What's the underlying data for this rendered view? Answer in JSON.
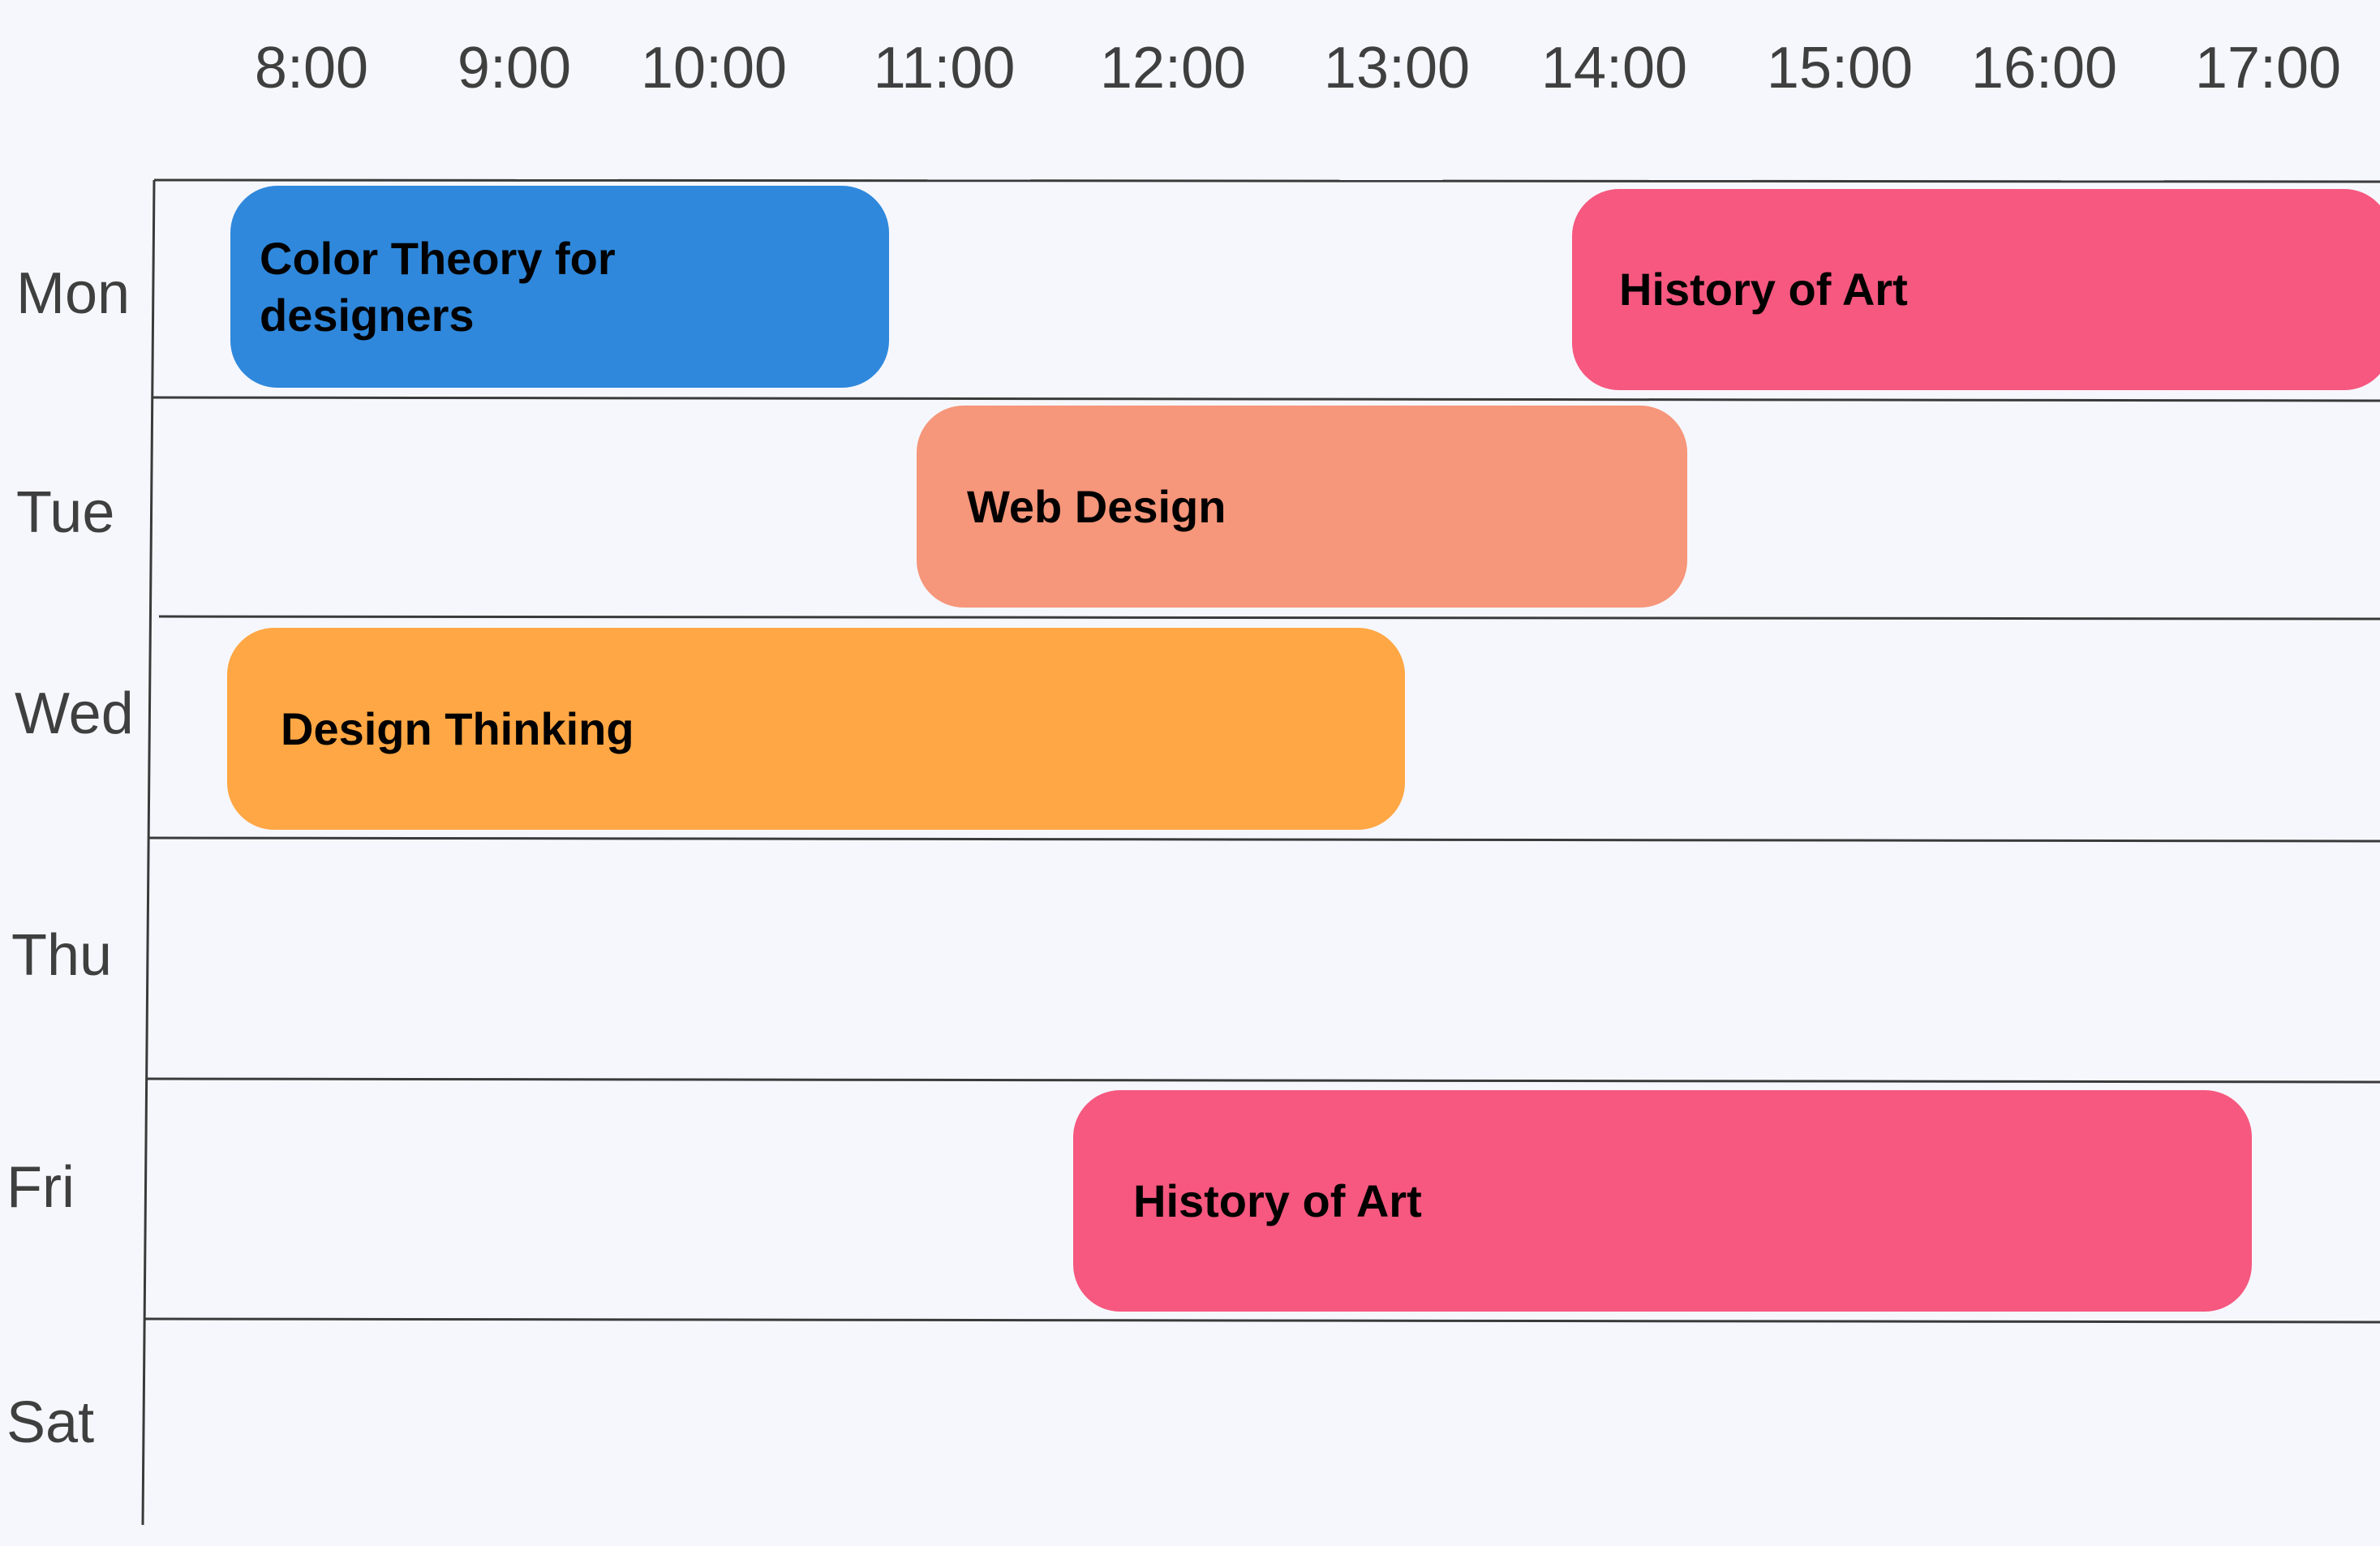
{
  "times": [
    "8:00",
    "9:00",
    "10:00",
    "11:00",
    "12:00",
    "13:00",
    "14:00",
    "15:00",
    "16:00",
    "17:00"
  ],
  "days": [
    "Mon",
    "Tue",
    "Wed",
    "Thu",
    "Fri",
    "Sat"
  ],
  "colors": {
    "background": "#f6f7fd",
    "gridline": "#3a3a3a",
    "label": "#3f3f3f",
    "event_text": "#000000"
  },
  "events": [
    {
      "title": "Color Theory for designers",
      "day": "Mon",
      "start": "8:00",
      "end": "11:00",
      "color": "#2f88dc"
    },
    {
      "title": "History of Art",
      "day": "Mon",
      "start": "14:00",
      "end": "18:00",
      "color": "#f6587f"
    },
    {
      "title": "Web Design",
      "day": "Tue",
      "start": "11:00",
      "end": "14:00",
      "color": "#f6967a"
    },
    {
      "title": "Design Thinking",
      "day": "Wed",
      "start": "8:00",
      "end": "13:00",
      "color": "#ffa744"
    },
    {
      "title": "History of Art",
      "day": "Fri",
      "start": "12:00",
      "end": "17:00",
      "color": "#f6587f"
    }
  ]
}
